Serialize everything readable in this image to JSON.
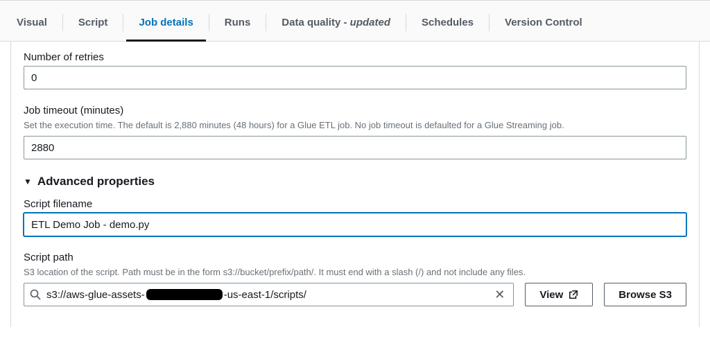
{
  "tabs": {
    "visual": "Visual",
    "script": "Script",
    "job_details": "Job details",
    "runs": "Runs",
    "data_quality_prefix": "Data quality - ",
    "data_quality_suffix": "updated",
    "schedules": "Schedules",
    "version_control": "Version Control"
  },
  "retries": {
    "label": "Number of retries",
    "value": "0"
  },
  "timeout": {
    "label": "Job timeout (minutes)",
    "help": "Set the execution time. The default is 2,880 minutes (48 hours) for a Glue ETL job. No job timeout is defaulted for a Glue Streaming job.",
    "value": "2880"
  },
  "advanced": {
    "title": "Advanced properties"
  },
  "script_filename": {
    "label": "Script filename",
    "value": "ETL Demo Job - demo.py"
  },
  "script_path": {
    "label": "Script path",
    "help": "S3 location of the script. Path must be in the form s3://bucket/prefix/path/. It must end with a slash (/) and not include any files.",
    "value_prefix": "s3://aws-glue-assets-",
    "value_suffix": "-us-east-1/scripts/",
    "view_label": "View",
    "browse_label": "Browse S3"
  }
}
